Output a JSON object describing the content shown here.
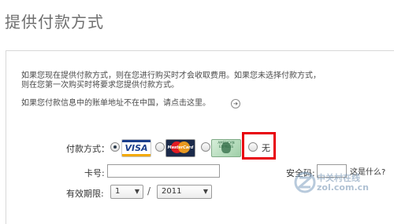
{
  "page": {
    "title": "提供付款方式"
  },
  "info": {
    "line1": "如果您现在提供付款方式，则在您进行购买时才会收取费用。如果您未选择付款方式，",
    "line2": "则在您第一次购买时将要求您提供付款方式。",
    "line3": "如果您付款信息中的账单地址不在中国，请点击这里。"
  },
  "payment": {
    "label": "付款方式：",
    "options": [
      {
        "name": "VISA",
        "checked": true
      },
      {
        "name": "MasterCard",
        "checked": false
      },
      {
        "name": "American Express",
        "checked": false
      },
      {
        "name": "无",
        "checked": false
      }
    ],
    "visa_text": "VISA",
    "mastercard_text": "MasterCard",
    "amex_text": "AMERICAN EXPRESS",
    "none_label": "无"
  },
  "card_number": {
    "label": "卡号:",
    "value": ""
  },
  "security_code": {
    "label": "安全码:",
    "value": "",
    "help_link": "这是什么?"
  },
  "expiry": {
    "label": "有效期限:",
    "month": "1",
    "year": "2011",
    "separator": "/"
  },
  "watermark": {
    "main": "中关村在线",
    "sub": "zol.com.cn"
  },
  "colors": {
    "highlight": "#e8000b",
    "title": "#6f6f6f",
    "visa_blue": "#1a3e8c"
  }
}
